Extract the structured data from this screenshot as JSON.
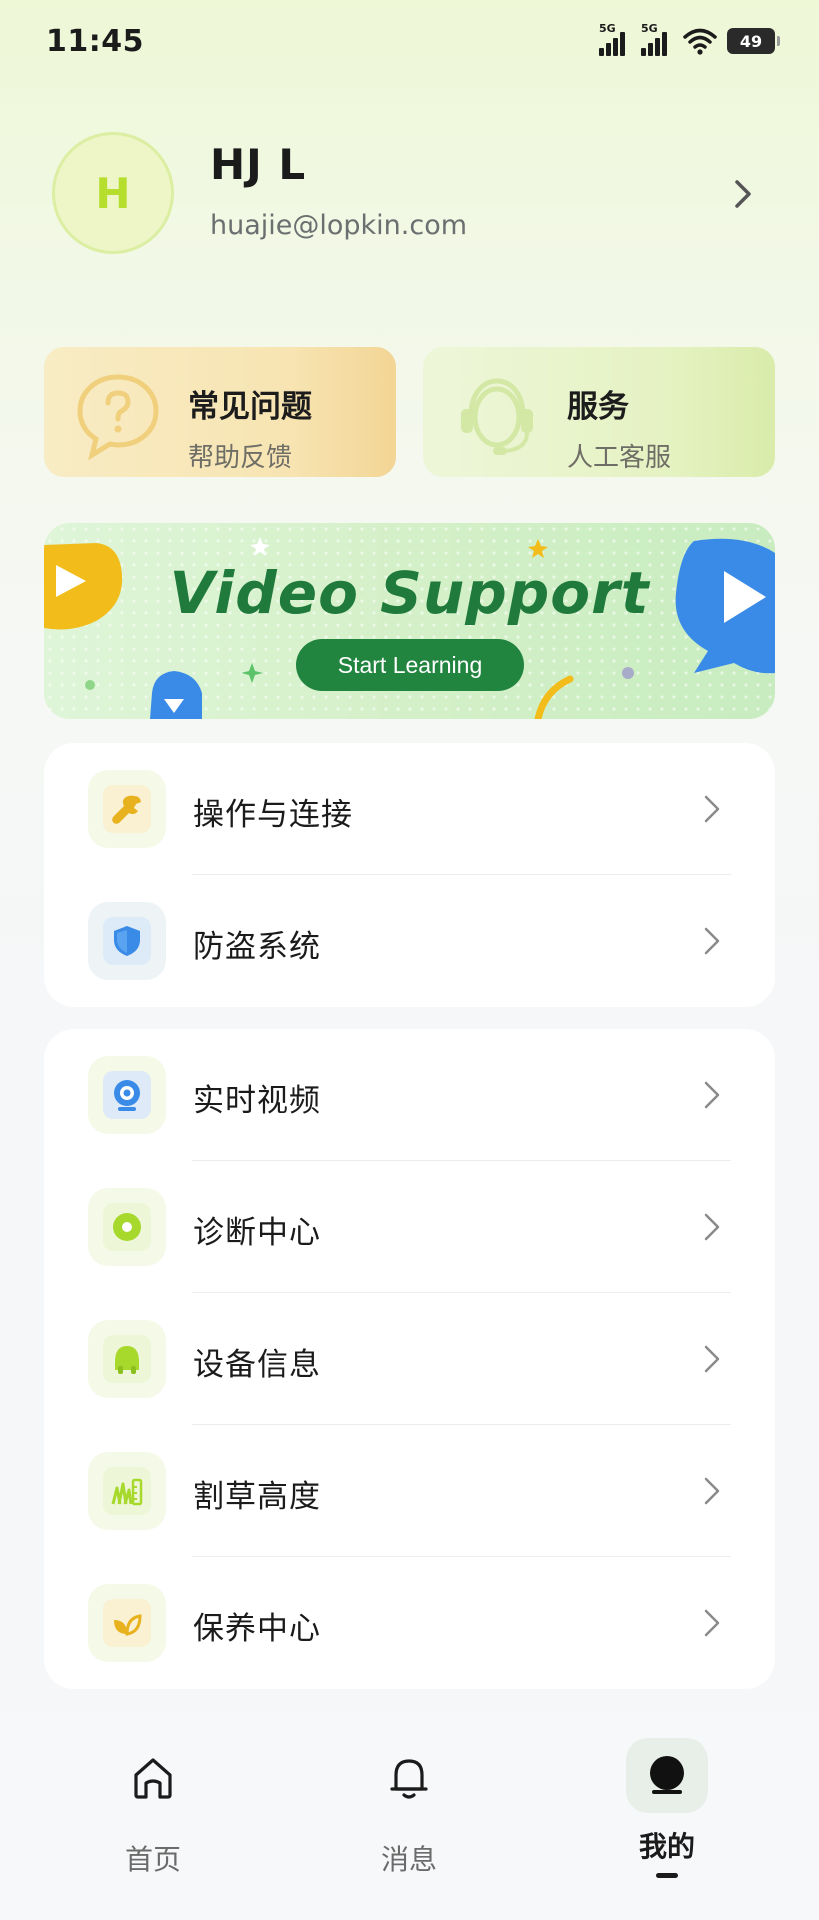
{
  "status_bar": {
    "time": "11:45",
    "signal1_tag": "5G",
    "signal2_tag": "5G",
    "battery": "49",
    "battery_level": 0.49
  },
  "profile": {
    "avatar_initial": "H",
    "name": "HJ L",
    "email": "huajie@lopkin.com"
  },
  "quick_cards": [
    {
      "title": "常见问题",
      "subtitle": "帮助反馈",
      "icon": "question-bubble-icon"
    },
    {
      "title": "服务",
      "subtitle": "人工客服",
      "icon": "headset-icon"
    }
  ],
  "banner": {
    "title": "Video Support",
    "button_label": "Start Learning"
  },
  "menu_group_1": [
    {
      "label": "操作与连接",
      "icon": "wrench-icon",
      "color": "#e8b21e"
    },
    {
      "label": "防盗系统",
      "icon": "shield-icon",
      "color": "#3a8be8"
    }
  ],
  "menu_group_2": [
    {
      "label": "实时视频",
      "icon": "camera-icon",
      "color": "#3a8be8"
    },
    {
      "label": "诊断中心",
      "icon": "diagnosis-icon",
      "color": "#a6d92c"
    },
    {
      "label": "设备信息",
      "icon": "mower-robot-icon",
      "color": "#a6d92c"
    },
    {
      "label": "割草高度",
      "icon": "grass-height-icon",
      "color": "#a6d92c"
    },
    {
      "label": "保养中心",
      "icon": "leaf-care-icon",
      "color": "#e8b21e"
    }
  ],
  "bottom_nav": [
    {
      "label": "首页",
      "icon": "home-icon",
      "active": false
    },
    {
      "label": "消息",
      "icon": "bell-icon",
      "active": false
    },
    {
      "label": "我的",
      "icon": "profile-icon",
      "active": true
    }
  ],
  "colors": {
    "accent_green": "#22853f",
    "lime": "#b5de2e",
    "blue": "#3a8be8",
    "yellow": "#e8b21e"
  }
}
